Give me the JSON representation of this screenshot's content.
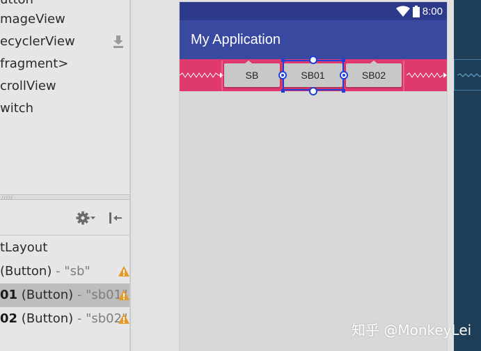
{
  "palette": {
    "items": [
      "utton",
      "mageView",
      "ecyclerView",
      "fragment>",
      "crollView",
      "witch"
    ]
  },
  "component_tree": {
    "root_label": "tLayout",
    "rows": [
      {
        "id": "",
        "type": "(Button)",
        "sep": " - ",
        "value": "\"sb\"",
        "selected": false
      },
      {
        "id": "01",
        "type": "(Button)",
        "sep": " - ",
        "value": "\"sb01\"",
        "selected": true
      },
      {
        "id": "02",
        "type": "(Button)",
        "sep": " - ",
        "value": "\"sb02\"",
        "selected": false
      }
    ]
  },
  "device": {
    "status_time": "8:00",
    "app_title": "My Application",
    "buttons": [
      "SB",
      "SB01",
      "SB02"
    ]
  },
  "colors": {
    "status_bar": "#2d3a8c",
    "app_bar": "#3949a0",
    "constraint_strip": "#e0396e",
    "blueprint": "#1e3f57",
    "warning": "#e39a2a",
    "selection": "#1f3fd6"
  },
  "icons": {
    "download": "download-icon",
    "gear": "gear-icon",
    "collapse": "collapse-icon",
    "warning": "warning-icon",
    "wifi": "wifi-icon",
    "battery": "battery-icon"
  },
  "watermark": "知乎 @MonkeyLei"
}
